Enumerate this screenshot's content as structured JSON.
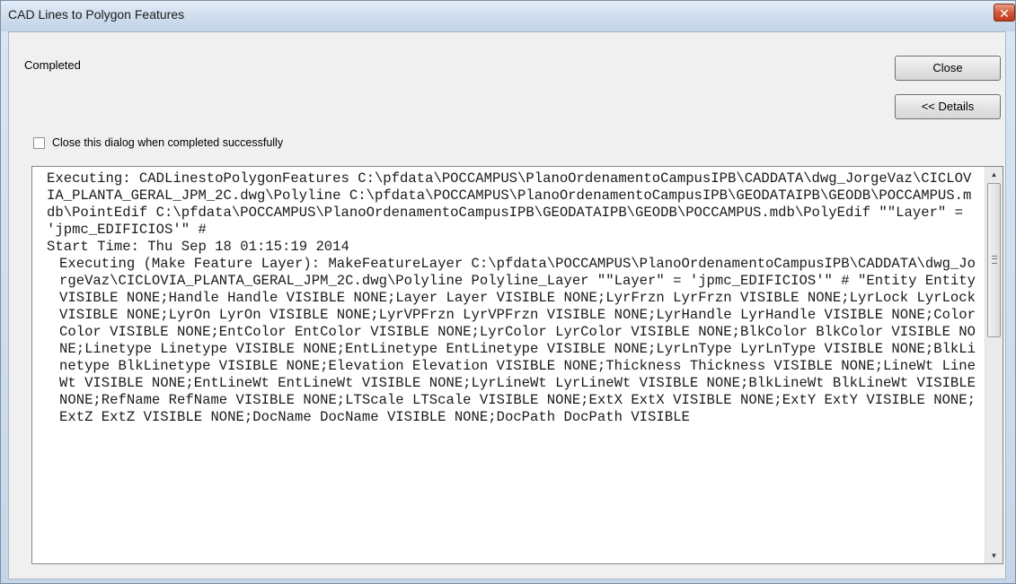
{
  "window": {
    "title": "CAD Lines to Polygon Features",
    "close_glyph": "✕"
  },
  "status": {
    "text": "Completed"
  },
  "buttons": {
    "close_label": "Close",
    "details_label": "<< Details"
  },
  "options": {
    "close_when_done_label": "Close this dialog when completed successfully",
    "close_when_done_checked": false
  },
  "log": {
    "lines": [
      "Executing: CADLinestoPolygonFeatures C:\\pfdata\\POCCAMPUS\\PlanoOrdenamentoCampusIPB\\CADDATA\\dwg_JorgeVaz\\CICLOVIA_PLANTA_GERAL_JPM_2C.dwg\\Polyline C:\\pfdata\\POCCAMPUS\\PlanoOrdenamentoCampusIPB\\GEODATAIPB\\GEODB\\POCCAMPUS.mdb\\PointEdif C:\\pfdata\\POCCAMPUS\\PlanoOrdenamentoCampusIPB\\GEODATAIPB\\GEODB\\POCCAMPUS.mdb\\PolyEdif \"\"Layer\" = 'jpmc_EDIFICIOS'\" #",
      "Start Time: Thu Sep 18 01:15:19 2014",
      "Executing (Make Feature Layer): MakeFeatureLayer C:\\pfdata\\POCCAMPUS\\PlanoOrdenamentoCampusIPB\\CADDATA\\dwg_JorgeVaz\\CICLOVIA_PLANTA_GERAL_JPM_2C.dwg\\Polyline Polyline_Layer \"\"Layer\" = 'jpmc_EDIFICIOS'\" # \"Entity Entity VISIBLE NONE;Handle Handle VISIBLE NONE;Layer Layer VISIBLE NONE;LyrFrzn LyrFrzn VISIBLE NONE;LyrLock LyrLock VISIBLE NONE;LyrOn LyrOn VISIBLE NONE;LyrVPFrzn LyrVPFrzn VISIBLE NONE;LyrHandle LyrHandle VISIBLE NONE;Color Color VISIBLE NONE;EntColor EntColor VISIBLE NONE;LyrColor LyrColor VISIBLE NONE;BlkColor BlkColor VISIBLE NONE;Linetype Linetype VISIBLE NONE;EntLinetype EntLinetype VISIBLE NONE;LyrLnType LyrLnType VISIBLE NONE;BlkLinetype BlkLinetype VISIBLE NONE;Elevation Elevation VISIBLE NONE;Thickness Thickness VISIBLE NONE;LineWt LineWt VISIBLE NONE;EntLineWt EntLineWt VISIBLE NONE;LyrLineWt LyrLineWt VISIBLE NONE;BlkLineWt BlkLineWt VISIBLE NONE;RefName RefName VISIBLE NONE;LTScale LTScale VISIBLE NONE;ExtX ExtX VISIBLE NONE;ExtY ExtY VISIBLE NONE;ExtZ ExtZ VISIBLE NONE;DocName DocName VISIBLE NONE;DocPath DocPath VISIBLE"
    ]
  },
  "scrollbar": {
    "up_glyph": "▲",
    "down_glyph": "▼"
  }
}
